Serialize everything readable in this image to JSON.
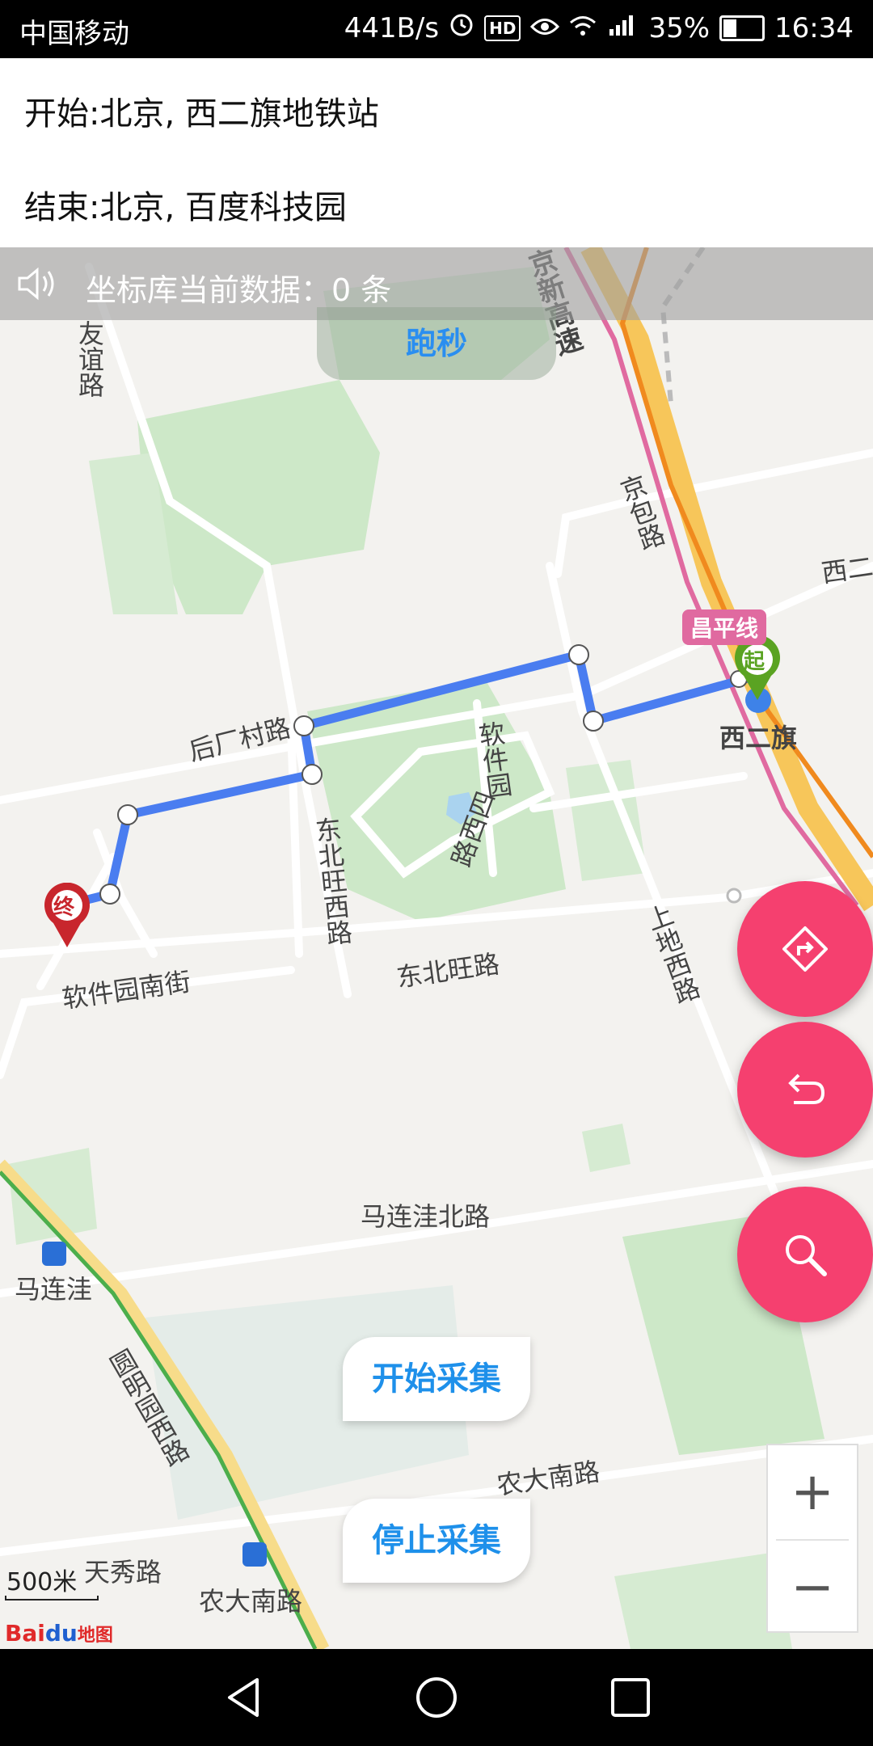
{
  "status_bar": {
    "carrier": "中国移动",
    "network_speed": "441B/s",
    "hd_badge": "HD",
    "battery": "35%",
    "time": "16:34"
  },
  "route_info": {
    "start": "开始:北京, 西二旗地铁站",
    "end": "结束:北京, 百度科技园"
  },
  "coord_bar": {
    "text": "坐标库当前数据：0 条"
  },
  "map_tab": {
    "label": "跑秒"
  },
  "map_labels": {
    "youyi_road": "友谊路",
    "jingxin_expressway": "京新高速",
    "jingbao_road": "京包路",
    "changping_line": "昌平线",
    "xierqi": "西二旗",
    "xier_partial": "西二",
    "start_marker": "起",
    "end_marker": "终",
    "houchangcun_road": "后厂村路",
    "ruanjianyuan_road": "软件园",
    "ruanjianyuan_west_road": "路西四",
    "dongbeiwang_west_road": "东北旺西路",
    "dongbeiwang_road": "东北旺路",
    "shangdi_west_road": "上地西路",
    "ruanjianyuan_south_street": "软件园南街",
    "malianwa_north_road": "马连洼北路",
    "malianwa": "马连洼",
    "yuanmingyuan_west_road": "圆明园西路",
    "nongda_south_road": "农大南路",
    "nongda_south_road_2": "农大南路",
    "tianxiu_road": "天秀路"
  },
  "buttons": {
    "start_collect": "开始采集",
    "stop_collect": "停止采集",
    "zoom_in": "+",
    "zoom_out": "−"
  },
  "scale": "500米",
  "logo": {
    "bai": "Bai",
    "du": "du",
    "ditu": "地图"
  },
  "colors": {
    "route": "#4a7df0",
    "fab": "#f5406f",
    "accent_text": "#1e90ea",
    "park": "#cde8c8"
  }
}
